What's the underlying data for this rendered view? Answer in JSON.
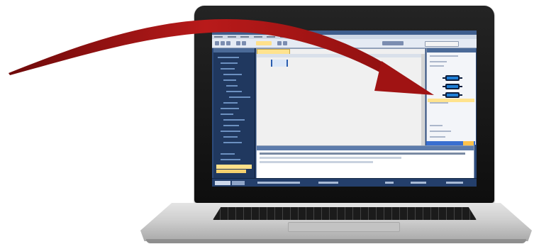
{
  "scene": {
    "description_kind": "laptop-with-arrow",
    "colors": {
      "arrow": "#9a1010",
      "arrow_highlight": "#c62222",
      "screen_chrome": "#2c4a7a",
      "toolbox_block": "#1f7fd6",
      "highlight": "#ffe08a"
    }
  },
  "icons": {
    "arrow": "curved-arrow-icon",
    "block": "function-block-icon"
  }
}
